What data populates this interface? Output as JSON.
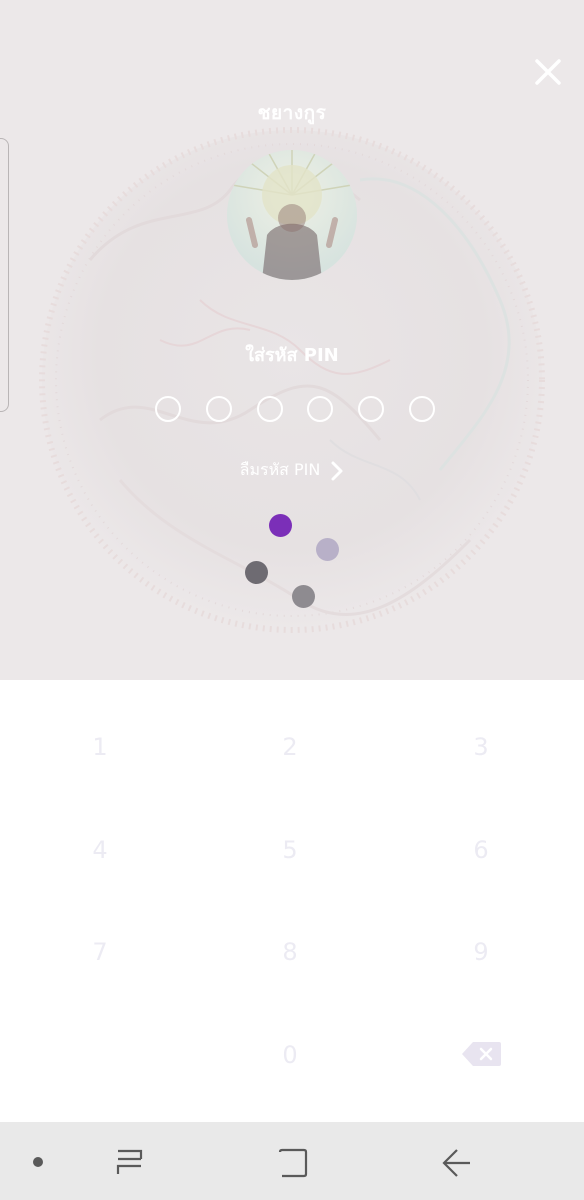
{
  "user": {
    "name": "ชยางกูร"
  },
  "pin": {
    "title": "ใส่รหัส PIN",
    "digits_entered": 0,
    "digit_count": 6,
    "forgot_label": "ลืมรหัส PIN"
  },
  "keypad": {
    "k1": "1",
    "k2": "2",
    "k3": "3",
    "k4": "4",
    "k5": "5",
    "k6": "6",
    "k7": "7",
    "k8": "8",
    "k9": "9",
    "k0": "0"
  },
  "colors": {
    "background": "#ece8e9",
    "spinner_primary": "#7b2fb8",
    "spinner_light": "#b8b0c8",
    "spinner_dark": "#6e6b72",
    "spinner_mid": "#8e8b90",
    "keypad_text": "#ecebf3",
    "navbar": "#e9e9e9"
  },
  "icons": {
    "close": "close-icon",
    "forgot_arrow": "chevron-right-icon",
    "backspace": "backspace-icon",
    "nav_recent": "recent-apps-icon",
    "nav_home": "home-icon",
    "nav_back": "back-icon"
  }
}
